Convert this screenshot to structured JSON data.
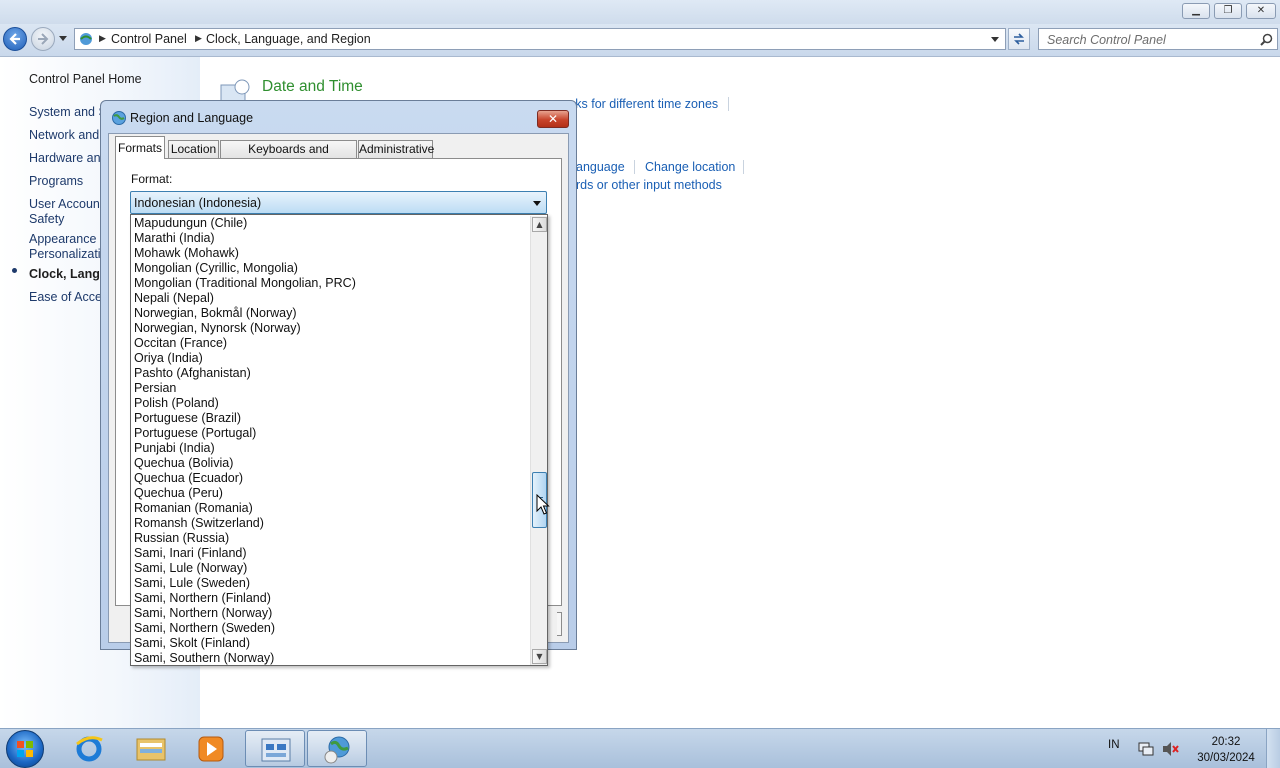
{
  "window": {
    "breadcrumbs": [
      "Control Panel",
      "Clock, Language, and Region"
    ],
    "search_placeholder": "Search Control Panel"
  },
  "sidebar": {
    "items": [
      {
        "label": "Control Panel Home",
        "current": false
      },
      {
        "label": "System and S",
        "current": false
      },
      {
        "label": "Network and",
        "current": false
      },
      {
        "label": "Hardware and",
        "current": false
      },
      {
        "label": "Programs",
        "current": false
      },
      {
        "label": "User Account",
        "current": false
      },
      {
        "label": "Safety",
        "current": false
      },
      {
        "label": "Appearance a",
        "current": false
      },
      {
        "label": "Personalizatio",
        "current": false
      },
      {
        "label": "Clock, Langua",
        "current": true
      },
      {
        "label": "Ease of Acces",
        "current": false
      }
    ]
  },
  "content": {
    "section_title": "Date and Time",
    "links": {
      "time_zones": "cks for different time zones",
      "language": "anguage",
      "change_location": "Change location",
      "input_methods": "ards or other input methods"
    }
  },
  "dialog": {
    "title": "Region and Language",
    "close_label": "✕",
    "tabs": [
      "Formats",
      "Location",
      "Keyboards and Languages",
      "Administrative"
    ],
    "active_tab": "Formats",
    "format_label": "Format:",
    "selected_format": "Indonesian (Indonesia)",
    "dropdown_items": [
      "Mapudungun (Chile)",
      "Marathi (India)",
      "Mohawk (Mohawk)",
      "Mongolian (Cyrillic, Mongolia)",
      "Mongolian (Traditional Mongolian, PRC)",
      "Nepali (Nepal)",
      "Norwegian, Bokmål (Norway)",
      "Norwegian, Nynorsk (Norway)",
      "Occitan (France)",
      "Oriya (India)",
      "Pashto (Afghanistan)",
      "Persian",
      "Polish (Poland)",
      "Portuguese (Brazil)",
      "Portuguese (Portugal)",
      "Punjabi (India)",
      "Quechua (Bolivia)",
      "Quechua (Ecuador)",
      "Quechua (Peru)",
      "Romanian (Romania)",
      "Romansh (Switzerland)",
      "Russian (Russia)",
      "Sami, Inari (Finland)",
      "Sami, Lule (Norway)",
      "Sami, Lule (Sweden)",
      "Sami, Northern (Finland)",
      "Sami, Northern (Norway)",
      "Sami, Northern (Sweden)",
      "Sami, Skolt (Finland)",
      "Sami, Southern (Norway)"
    ],
    "scroll_position_fraction": 0.6
  },
  "taskbar": {
    "pinned": [
      "internet-explorer",
      "windows-explorer",
      "media-player",
      "control-panel",
      "region-and-language"
    ],
    "tray_language": "IN",
    "time": "20:32",
    "date": "30/03/2024"
  },
  "colors": {
    "link_blue": "#1a5fb4",
    "title_green": "#2f8f2f",
    "selection_blue": "#3c7fb1"
  }
}
